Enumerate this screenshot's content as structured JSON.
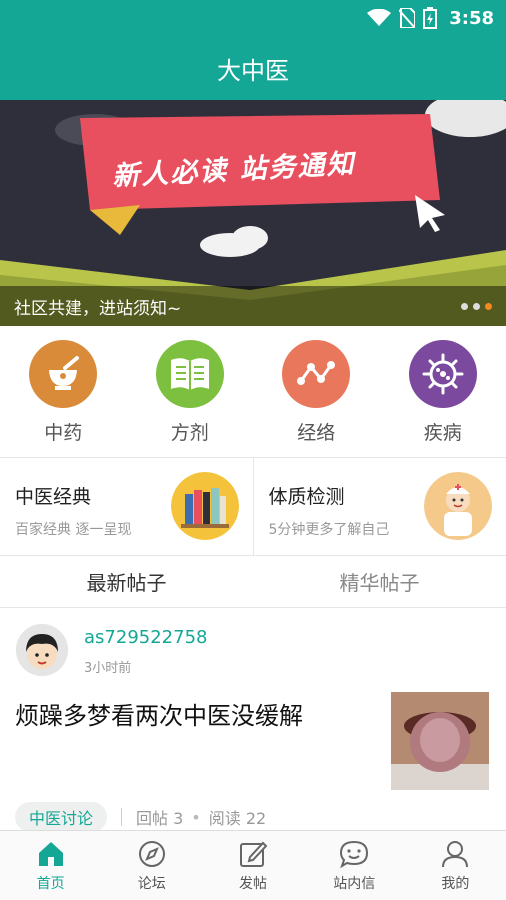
{
  "status_bar": {
    "time": "3:58"
  },
  "app": {
    "title": "大中医"
  },
  "banner": {
    "headline": "新人必读 站务通知",
    "caption": "社区共建，进站须知~",
    "dots": 3,
    "active_dot": 2
  },
  "categories": [
    {
      "label": "中药",
      "icon": "mortar-icon",
      "color": "#d98b3a"
    },
    {
      "label": "方剂",
      "icon": "book-icon",
      "color": "#7dbf3f"
    },
    {
      "label": "经络",
      "icon": "meridian-icon",
      "color": "#e8775c"
    },
    {
      "label": "疾病",
      "icon": "virus-icon",
      "color": "#7b4a9e"
    }
  ],
  "features": [
    {
      "title": "中医经典",
      "subtitle": "百家经典 逐一呈现",
      "icon": "books-icon"
    },
    {
      "title": "体质检测",
      "subtitle": "5分钟更多了解自己",
      "icon": "doctor-icon"
    }
  ],
  "tabs": [
    {
      "label": "最新帖子",
      "active": true
    },
    {
      "label": "精华帖子",
      "active": false
    }
  ],
  "post": {
    "author": "as729522758",
    "time": "3小时前",
    "title": "烦躁多梦看两次中医没缓解",
    "tag": "中医讨论",
    "replies": "回帖 3",
    "reads": "阅读 22"
  },
  "bottom_nav": [
    {
      "label": "首页",
      "icon": "home-icon",
      "active": true
    },
    {
      "label": "论坛",
      "icon": "compass-icon",
      "active": false
    },
    {
      "label": "发帖",
      "icon": "compose-icon",
      "active": false
    },
    {
      "label": "站内信",
      "icon": "message-icon",
      "active": false
    },
    {
      "label": "我的",
      "icon": "profile-icon",
      "active": false
    }
  ],
  "colors": {
    "primary": "#14a796",
    "banner_red": "#e84f5f",
    "active_dot": "#f28a1e"
  }
}
